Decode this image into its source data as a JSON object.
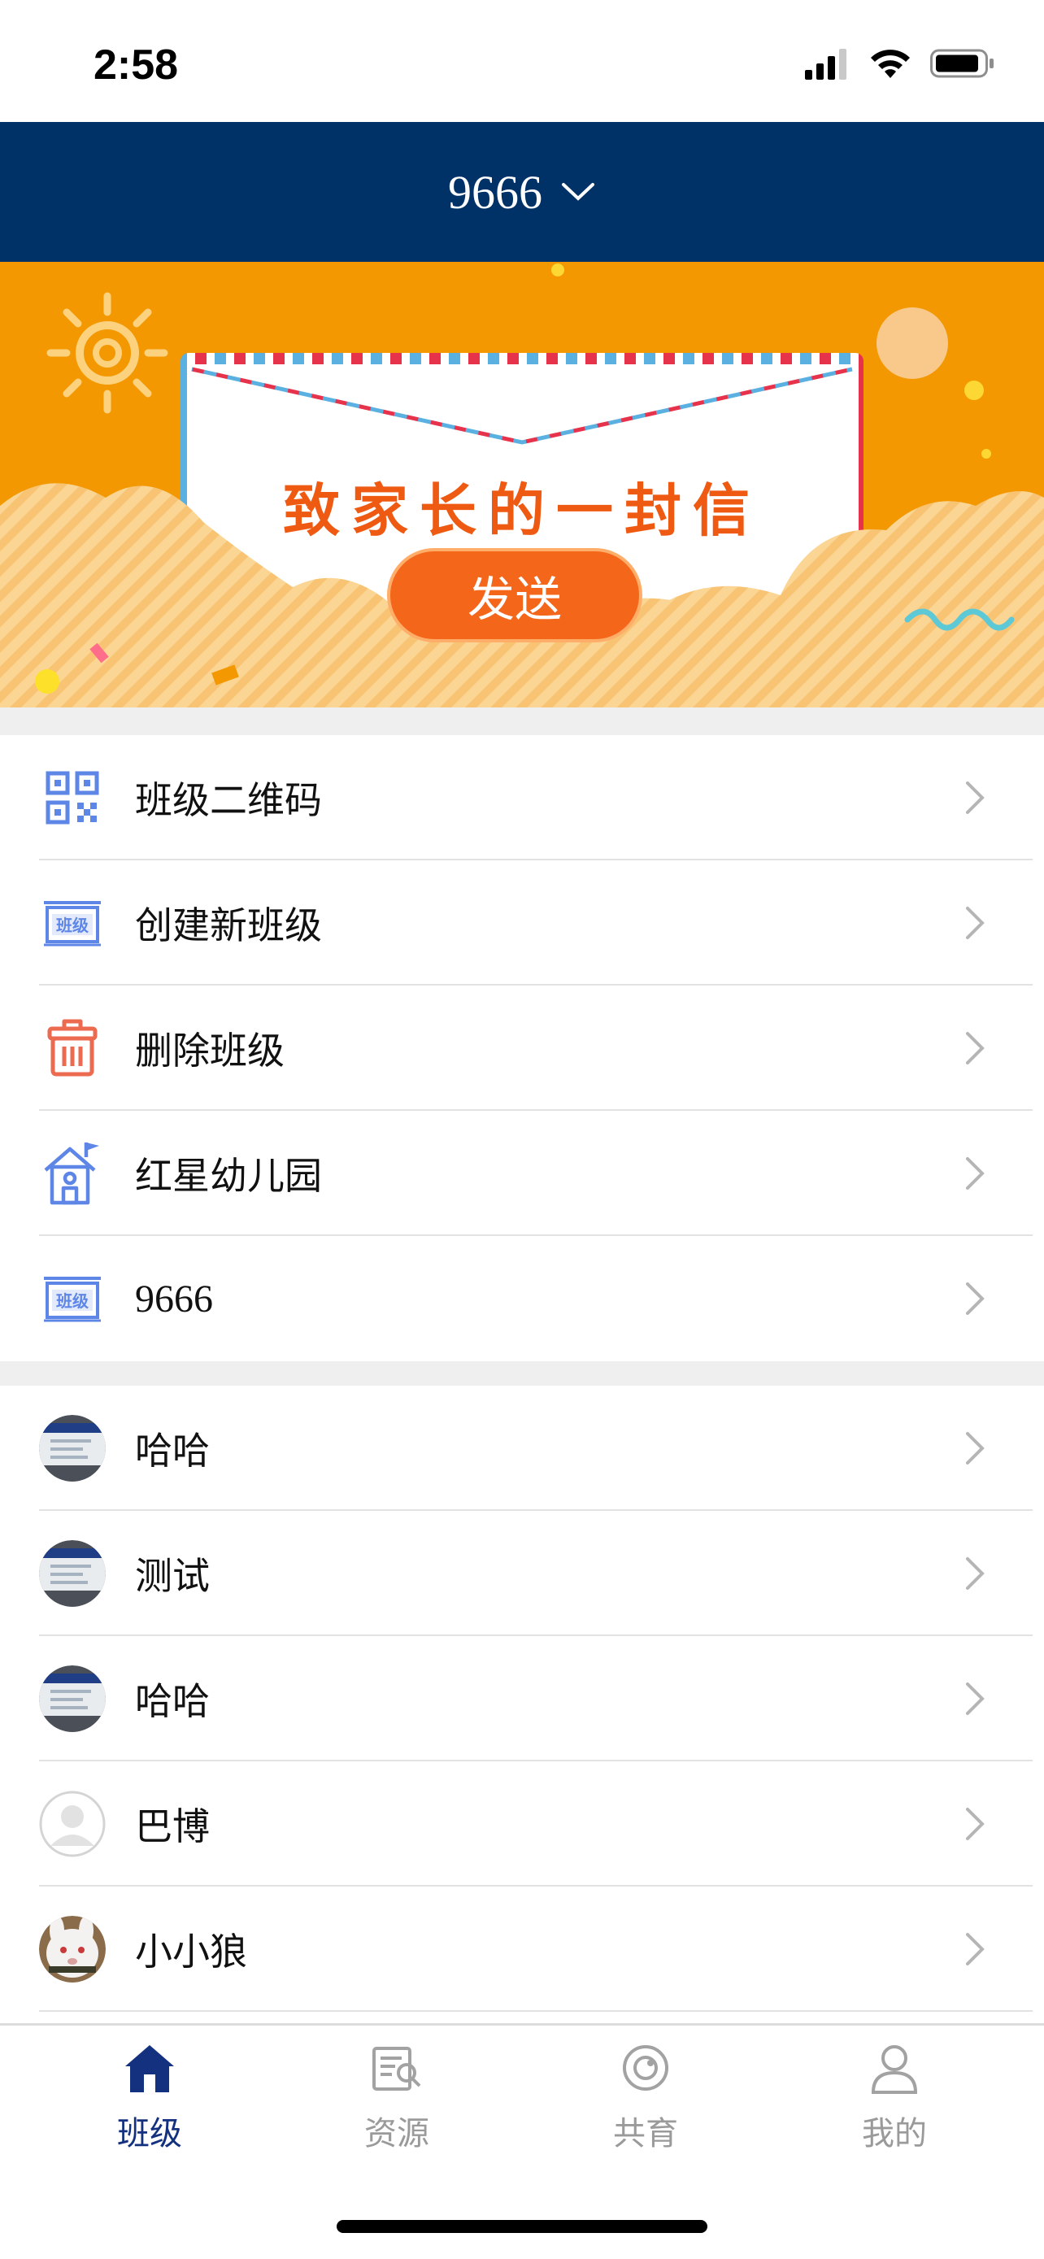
{
  "status_bar": {
    "time": "2:58"
  },
  "header": {
    "title": "9666"
  },
  "banner": {
    "letter_text": "致家长的一封信",
    "send_label": "发送"
  },
  "menu": [
    {
      "label": "班级二维码",
      "icon": "qr-code-icon"
    },
    {
      "label": "创建新班级",
      "icon": "class-sign-icon"
    },
    {
      "label": "删除班级",
      "icon": "trash-icon"
    },
    {
      "label": "红星幼儿园",
      "icon": "school-house-icon"
    },
    {
      "label": "9666",
      "icon": "class-sign-icon"
    }
  ],
  "members": [
    {
      "name": "哈哈",
      "avatar": "photo-avatar"
    },
    {
      "name": "测试",
      "avatar": "photo-avatar"
    },
    {
      "name": "哈哈",
      "avatar": "photo-avatar"
    },
    {
      "name": "巴博",
      "avatar": "default-avatar"
    },
    {
      "name": "小小狼",
      "avatar": "bunny-avatar"
    }
  ],
  "tabs": [
    {
      "label": "班级",
      "icon": "home-icon",
      "active": true
    },
    {
      "label": "资源",
      "icon": "resource-search-icon",
      "active": false
    },
    {
      "label": "共育",
      "icon": "co-education-icon",
      "active": false
    },
    {
      "label": "我的",
      "icon": "person-icon",
      "active": false
    }
  ],
  "colors": {
    "header": "#013267",
    "banner": "#f39800",
    "accent": "#13317f",
    "button": "#f4671b"
  }
}
